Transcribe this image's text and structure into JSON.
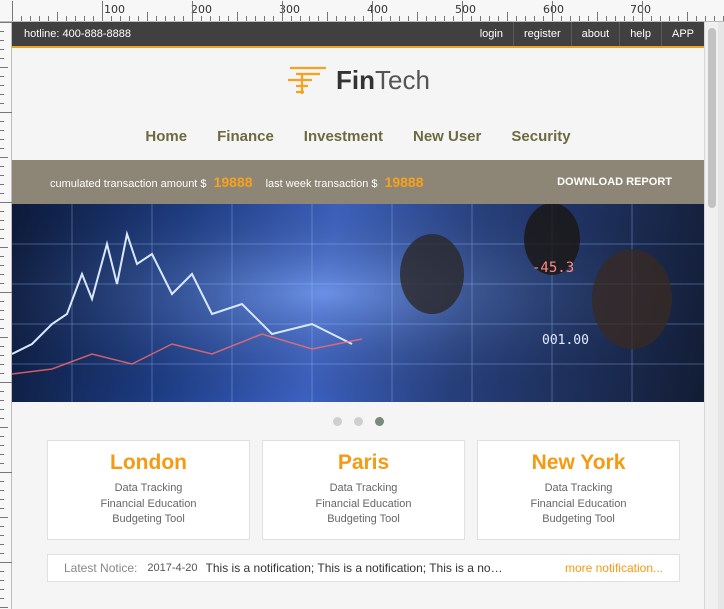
{
  "ruler": {
    "labels": [
      "100",
      "200",
      "300",
      "400",
      "500",
      "600",
      "700"
    ]
  },
  "topbar": {
    "hotline": "hotline: 400-888-8888",
    "links": [
      "login",
      "register",
      "about",
      "help",
      "APP"
    ]
  },
  "brand": {
    "name_bold": "Fin",
    "name_light": "Tech",
    "logo_icon": "fintech-logo-icon",
    "logo_color": "#f7a21c"
  },
  "nav": [
    "Home",
    "Finance",
    "Investment",
    "New User",
    "Security"
  ],
  "stats": {
    "cumulated_label": "cumulated transaction amount $",
    "cumulated_value": "19888",
    "lastweek_label": "last week transaction $",
    "lastweek_value": "19888",
    "download": "DOWNLOAD REPORT"
  },
  "banner": {
    "overlay_text": [
      "-45.3",
      "001.00"
    ]
  },
  "carousel": {
    "count": 3,
    "active_index": 2
  },
  "cards": [
    {
      "title": "London",
      "items": [
        "Data Tracking",
        "Financial Education",
        "Budgeting Tool"
      ]
    },
    {
      "title": "Paris",
      "items": [
        "Data Tracking",
        "Financial Education",
        "Budgeting Tool"
      ]
    },
    {
      "title": "New York",
      "items": [
        "Data Tracking",
        "Financial Education",
        "Budgeting Tool"
      ]
    }
  ],
  "notice": {
    "label": "Latest Notice:",
    "date": "2017-4-20",
    "text": "This is a notification; This is a notification; This is a notification;",
    "more": "more notification..."
  },
  "colors": {
    "accent": "#f7a21c",
    "nav_text": "#6d6a40",
    "topbar": "#404040",
    "statsbar": "#8d8576"
  }
}
